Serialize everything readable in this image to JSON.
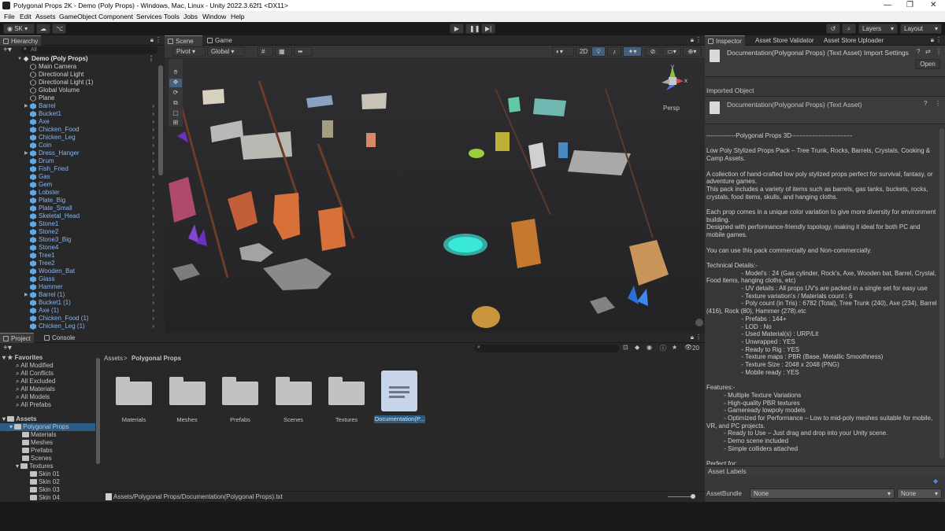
{
  "window": {
    "title": "Polygonal Props 2K - Demo (Poly Props) - Windows, Mac, Linux - Unity 2022.3.62f1 <DX11>"
  },
  "menu": [
    "File",
    "Edit",
    "Assets",
    "GameObject",
    "Component",
    "Services",
    "Tools",
    "Jobs",
    "Window",
    "Help"
  ],
  "toolbar": {
    "account": "SK",
    "layers": "Layers",
    "layout": "Layout"
  },
  "hierarchy": {
    "tab": "Hierarchy",
    "search_placeholder": "All",
    "root": "Demo (Poly Props)",
    "items": [
      "Main Camera",
      "Directional Light",
      "Directional Light (1)",
      "Global Volume",
      "Plane",
      "Barrel",
      "Bucket1",
      "Axe",
      "Chicken_Food",
      "Chicken_Leg",
      "Coin",
      "Dress_Hanger",
      "Drum",
      "Fish_Fried",
      "Gas",
      "Gem",
      "Lobster",
      "Plate_Big",
      "Plate_Small",
      "Skeletal_Head",
      "Stone1",
      "Stone2",
      "Stone3_Big",
      "Stone4",
      "Tree1",
      "Tree2",
      "Wooden_Bat",
      "Glass",
      "Hammer",
      "Barrel (1)",
      "Bucket1 (1)",
      "Axe (1)",
      "Chicken_Food (1)",
      "Chicken_Leg (1)"
    ]
  },
  "scene": {
    "tabs": [
      "Scene",
      "Game"
    ],
    "pivot": "Pivot",
    "global": "Global",
    "mode_2d": "2D",
    "persp": "Persp",
    "gizmo_y": "y",
    "gizmo_x": "x"
  },
  "inspector": {
    "tabs": [
      "Inspector",
      "Asset Store Validator",
      "Asset Store Uploader"
    ],
    "title": "Documentation(Polygonal Props) (Text Asset) Import Settings",
    "open": "Open",
    "imported": "Imported Object",
    "asset": "Documentation(Polygonal Props) (Text Asset)",
    "body": "--------------Polygonal Props 3D-----------------------------\n\nLow Poly Stylized Props Pack – Tree Trunk, Rocks, Barrels, Crystals, Cooking & Camp Assets.\n\nA collection of hand-crafted low poly stylized props perfect for survival, fantasy, or adventure games.\nThis pack includes a variety of items such as barrels, gas tanks, buckets, rocks, crystals, food items, skulls, and hanging cloths.\n\nEach prop comes in a unique color variation to give more diversity for environment building.\nDesigned with performance-friendly topology, making it ideal for both PC and mobile games.\n\nYou can use this pack commercially and Non-commercially.\n\nTechnical Details:-\n                    - Model's : 24 (Gas cylinder, Rock's, Axe, Wooden bat, Barrel, Crystal, Food items, hanging cloths, etc)\n                    - UV details : All props UV's are packed in a single set for easy use\n                    - Texture variation's / Materials count : 6\n                    - Poly count (in Tris) : 6782 (Total), Tree Trunk (240), Axe (234), Barrel (416), Rock (80), Hammer (278).etc\n                    - Prefabs : 144+\n                    - LOD : No\n                    - Used Material(s) : URP/Lit\n                    - Unwrapped : YES\n                    - Ready to Rig : YES\n                    - Texture maps : PBR (Base, Metallic Smoothness)\n                    - Texture Size : 2048 x 2048 (PNG)\n                    - Mobile ready : YES\n\nFeatures:-\n          - Multiple Texture Variations\n          - High-quality PBR textures\n          - Gameready lowpoly models\n          - Optimized for Performance – Low to mid-poly meshes suitable for mobile, VR, and PC projects.\n          - Ready to Use – Just drag and drop into your Unity scene.\n          - Demo scene included\n          - Simple colliders attached\n\nPerfect for:\n- Survival bases",
    "labels": "Asset Labels",
    "bundle_label": "AssetBundle",
    "bundle_value": "None",
    "variant_value": "None"
  },
  "project": {
    "tabs": [
      "Project",
      "Console"
    ],
    "favorites": "Favorites",
    "fav_items": [
      "All Modified",
      "All Conflicts",
      "All Excluded",
      "All Materials",
      "All Models",
      "All Prefabs"
    ],
    "assets": "Assets",
    "tree": [
      "Polygonal Props",
      "Materials",
      "Meshes",
      "Prefabs",
      "Scenes",
      "Textures",
      "Skin 01",
      "Skin 02",
      "Skin 03",
      "Skin 04"
    ],
    "breadcrumb": [
      "Assets",
      ">",
      "Polygonal Props"
    ],
    "count": "20",
    "folders": [
      "Materials",
      "Meshes",
      "Prefabs",
      "Scenes",
      "Textures"
    ],
    "doc": "Documentation(P...",
    "path": "Assets/Polygonal Props/Documentation(Polygonal Props).txt"
  },
  "colors": {
    "accent": "#4a8adb",
    "selected": "#2c5d87",
    "panel": "#282828"
  }
}
